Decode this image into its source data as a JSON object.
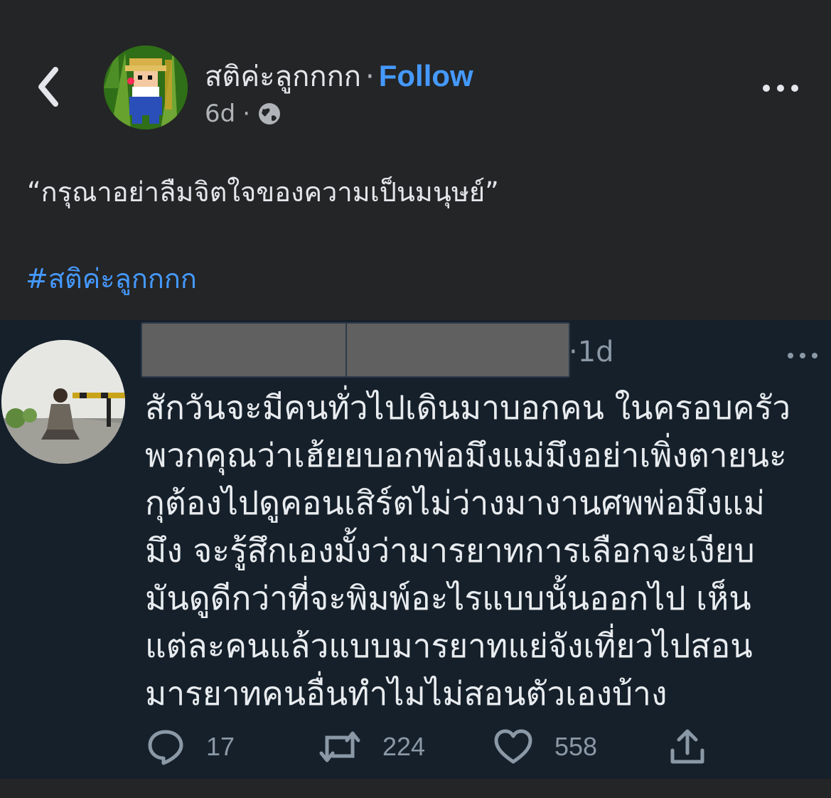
{
  "post": {
    "page_name": "สติค่ะลูกกกก",
    "separator": "·",
    "follow_label": "Follow",
    "time": "6d",
    "meta_separator": "·",
    "privacy_icon": "globe-icon",
    "quote": "“กรุณาอย่าลืมจิตใจของความเป็นมนุษย์”",
    "hashtag": "#สติค่ะลูกกกก"
  },
  "tweet": {
    "time": "·1d",
    "lines": [
      "สักวันจะมีคนทั่วไปเดินมาบอกคน ในครอบครัว",
      "พวกคุณว่าเฮ้ยยบอกพ่อมึงแม่มึงอย่าเพิ่งตายนะ",
      "กุต้องไปดูคอนเสิร์ตไม่ว่างมางานศพพ่อมึงแม่",
      "มึง  จะรู้สึกเองมั้งว่ามารยาทการเลือกจะเงียบ",
      "มันดูดีกว่าที่จะพิมพ์อะไรแบบนั้นออกไป  เห็น",
      "แต่ละคนแล้วแบบมารยาทแย่จังเที่ยวไปสอน",
      "มารยาทคนอื่นทำไมไม่สอนตัวเองบ้าง"
    ],
    "replies": "17",
    "retweets": "224",
    "likes": "558"
  },
  "colors": {
    "facebook_bg": "#242526",
    "link_blue": "#4599ff",
    "tweet_bg": "#15202b",
    "muted": "#8b98a5"
  }
}
